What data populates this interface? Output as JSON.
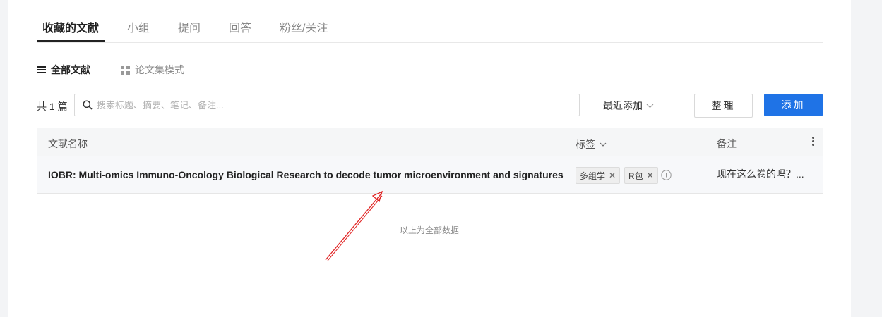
{
  "tabs": [
    {
      "label": "收藏的文献"
    },
    {
      "label": "小组"
    },
    {
      "label": "提问"
    },
    {
      "label": "回答"
    },
    {
      "label": "粉丝/关注"
    }
  ],
  "views": {
    "all": {
      "label": "全部文献",
      "icon": "list-icon"
    },
    "collection": {
      "label": "论文集模式",
      "icon": "grid-icon"
    }
  },
  "toolbar": {
    "count_label": "共 1 篇",
    "search_placeholder": "搜索标题、摘要、笔记、备注...",
    "sort_label": "最近添加",
    "organize_label": "整理",
    "add_label": "添加"
  },
  "table": {
    "headers": {
      "name": "文献名称",
      "tags": "标签",
      "notes": "备注"
    },
    "rows": [
      {
        "title": "IOBR: Multi-omics Immuno-Oncology Biological Research to decode tumor microenvironment and signatures",
        "tags": [
          "多组学",
          "R包"
        ],
        "note": "现在这么卷的吗？..."
      }
    ]
  },
  "footer": {
    "end_text": "以上为全部数据"
  },
  "colors": {
    "accent": "#1f73e6",
    "annotation_arrow": "#e02020"
  }
}
